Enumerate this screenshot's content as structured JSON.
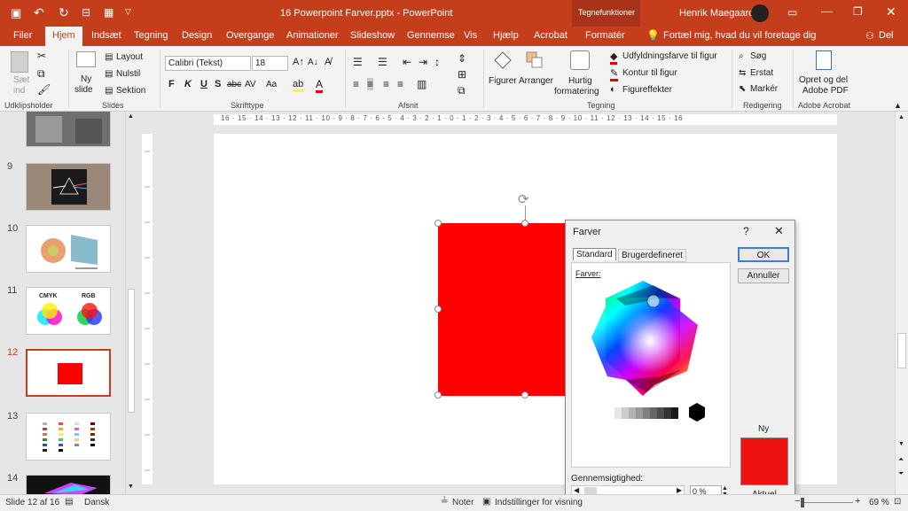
{
  "window": {
    "doc_title": "16 Powerpoint Farver.pptx - PowerPoint",
    "context_tab_group": "Tegnefunktioner",
    "user_name": "Henrik Maegaard"
  },
  "tabs": [
    "Filer",
    "Hjem",
    "Indsæt",
    "Tegning",
    "Design",
    "Overgange",
    "Animationer",
    "Slideshow",
    "Gennemse",
    "Vis",
    "Hjælp",
    "Acrobat",
    "Formatér"
  ],
  "tell_me": "Fortæl mig, hvad du vil foretage dig",
  "share": "Del",
  "ribbon": {
    "clipboard": {
      "paste": "Sæt",
      "paste2": "ind",
      "label": "Udklipsholder"
    },
    "slides": {
      "new": "Ny",
      "new2": "slide",
      "layout": "Layout",
      "reset": "Nulstil",
      "section": "Sektion",
      "label": "Slides"
    },
    "font": {
      "family": "Calibri (Tekst)",
      "size": "18",
      "bold": "F",
      "italic": "K",
      "underline": "U",
      "shadow": "S",
      "strike": "abc",
      "spacing": "AV",
      "case": "Aa",
      "label": "Skrifttype"
    },
    "paragraph": {
      "label": "Afsnit"
    },
    "drawing": {
      "shapes": "Figurer",
      "arrange": "Arranger",
      "quick1": "Hurtig",
      "quick2": "formatering",
      "fill": "Udfyldningsfarve til figur",
      "outline": "Kontur til figur",
      "effects": "Figureffekter",
      "label": "Tegning"
    },
    "editing": {
      "find": "Søg",
      "replace": "Erstat",
      "select": "Markér",
      "label": "Redigering"
    },
    "acrobat": {
      "line1": "Opret og del",
      "line2": "Adobe PDF",
      "label": "Adobe Acrobat"
    }
  },
  "thumbnails": [
    {
      "num": "9"
    },
    {
      "num": "10"
    },
    {
      "num": "11",
      "text1": "CMYK",
      "text2": "RGB"
    },
    {
      "num": "12"
    },
    {
      "num": "13"
    },
    {
      "num": "14"
    }
  ],
  "ruler_labels": "16 · 15 · 14 · 13 · 12 · 11 · 10 · 9 · 8 · 7 · 6 · 5 · 4 · 3 · 2 · 1 · 0 · 1 · 2 · 3 · 4 · 5 · 6 · 7 · 8 · 9 · 10 · 11 · 12 · 13 · 14 · 15 · 16",
  "dialog": {
    "title": "Farver",
    "help": "?",
    "close": "✕",
    "tab_standard": "Standard",
    "tab_custom": "Brugerdefineret",
    "colors_label": "Farver:",
    "ok": "OK",
    "cancel": "Annuller",
    "new_label": "Ny",
    "current_label": "Aktuel",
    "transparency_label": "Gennemsigtighed:",
    "transparency_value": "0 %",
    "new_color": "#ee1111"
  },
  "status": {
    "slide": "Slide 12 af 16",
    "language": "Dansk",
    "notes": "Noter",
    "view_settings": "Indstillinger for visning",
    "zoom": "69 %"
  },
  "colors": {
    "accent": "#c43e1c",
    "shape": "#ff0000"
  }
}
